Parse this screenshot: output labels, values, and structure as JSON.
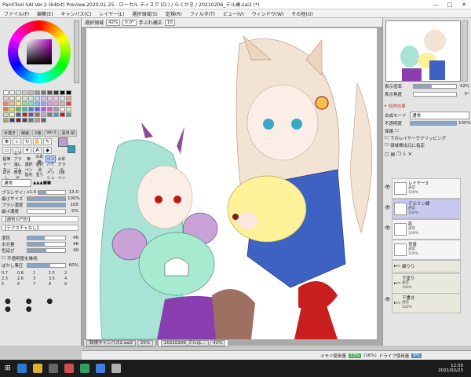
{
  "window": {
    "title": "PaintTool SAI Ver.2 (64bit) Preview.2020.01.25 - ローカル ディスク (D:) / らくがき / 20210206_デル歳.sai2 (*)",
    "minimize": "—",
    "maximize": "□",
    "close": "✕"
  },
  "menu": [
    "ファイル(F)",
    "編集(E)",
    "キャンバス(C)",
    "レイヤー(L)",
    "選択領域(S)",
    "定規(R)",
    "フィルタ(T)",
    "ビュー(V)",
    "ウィンドウ(W)",
    "その他(O)"
  ],
  "canvas_toolbar": {
    "mode": "選択領域",
    "zoom": "42%",
    "angle": "0.0°",
    "stabilizer_label": "手ぶれ補正",
    "stabilizer": "10"
  },
  "left": {
    "tool_tabs": [
      "手描き",
      "線画",
      "2値",
      "Ver.2",
      "素材 耐"
    ],
    "brushes": [
      [
        "鉛筆",
        "エアブラシ",
        "筆",
        "水彩筆",
        "ペン",
        "水彩"
      ],
      [
        "マーカー",
        "消しゴム",
        "選択ペン",
        "選択消",
        "バケツ",
        "グラデ"
      ],
      [
        "ぼかし",
        "色混ぜ",
        "指先",
        "塗り",
        "メッシュ",
        "2値ペン"
      ]
    ],
    "blend": "通常",
    "params": [
      {
        "label": "ブラシサイズ",
        "mult": "x1.0",
        "value": "13.0",
        "fill": 0.3
      },
      {
        "label": "最小サイズ",
        "value": "100%",
        "fill": 1.0
      },
      {
        "label": "ブラシ濃度",
        "value": "100",
        "fill": 1.0
      },
      {
        "label": "最小濃度",
        "value": "0%",
        "fill": 0.0
      }
    ],
    "shape_label": "【通常の円形】",
    "texture_label": "【テクスチャなし】",
    "mix_params": [
      {
        "label": "混色",
        "value": "46",
        "fill": 0.46
      },
      {
        "label": "水分量",
        "value": "46",
        "fill": 0.46
      },
      {
        "label": "色延び",
        "value": "49",
        "fill": 0.49
      }
    ],
    "keep_opacity": "不透明度を維持",
    "blur_label": "ぼかし筆圧",
    "blur_value": "60%",
    "sizes": [
      "0.7",
      "0.8",
      "1",
      "1.5",
      "2",
      "2.3",
      "2.6",
      "3",
      "3.5",
      "4",
      "5",
      "6",
      "7",
      "8",
      "9"
    ]
  },
  "right": {
    "display_opacity_label": "表示倍率",
    "display_opacity": "42%",
    "display_angle_label": "表示角度",
    "display_angle": "0°",
    "effects_label": "特殊効果",
    "blend_mode_label": "合成モード",
    "blend_mode": "通常",
    "opacity_label": "不透明度",
    "opacity": "100%",
    "protect_label": "保護",
    "clip_label": "下のレイヤーでクリッピング",
    "select_src_label": "領域検出元に指定",
    "layers": [
      {
        "name": "レイヤー3",
        "mode": "通常",
        "opacity": "100%"
      },
      {
        "name": "デルミン線",
        "mode": "通常",
        "opacity": "100%"
      },
      {
        "name": "影",
        "mode": "通常",
        "opacity": "100%"
      },
      {
        "name": "背景",
        "mode": "通常",
        "opacity": "100%"
      },
      {
        "name": "線りり",
        "mode": "",
        "opacity": ""
      },
      {
        "name": "下塗り",
        "mode": "通常",
        "opacity": "100%"
      },
      {
        "name": "下書き",
        "mode": "通常",
        "opacity": "100%"
      }
    ]
  },
  "doc_tabs": [
    {
      "name": "新規キャンバス2.sai2",
      "zoom": "25%"
    },
    {
      "name": "20210206_デルは...",
      "zoom": "42%"
    }
  ],
  "status": {
    "mem_label": "メモリ使用量",
    "mem": "13%",
    "mem2": "(16%)",
    "drive_label": "ドライブ使用量",
    "drive": "8%"
  },
  "clock": {
    "time": "12:50",
    "date": "2021/02/23"
  },
  "colors": {
    "accent": "#b000c0"
  }
}
